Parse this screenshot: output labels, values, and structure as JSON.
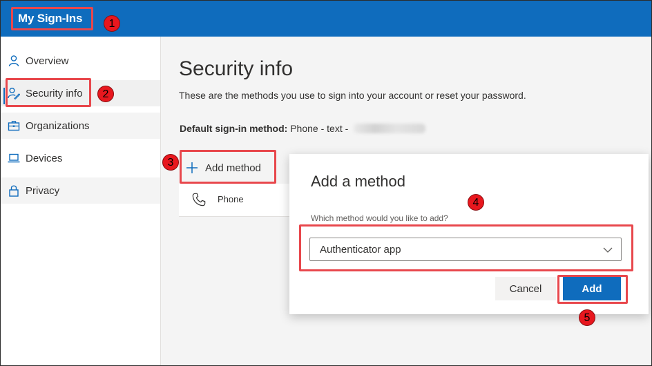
{
  "header": {
    "app_title": "My Sign-Ins"
  },
  "sidebar": {
    "items": [
      {
        "label": "Overview",
        "icon": "person-icon"
      },
      {
        "label": "Security info",
        "icon": "person-key-icon",
        "active": true
      },
      {
        "label": "Organizations",
        "icon": "briefcase-icon"
      },
      {
        "label": "Devices",
        "icon": "laptop-icon"
      },
      {
        "label": "Privacy",
        "icon": "lock-icon"
      }
    ]
  },
  "main": {
    "title": "Security info",
    "subtitle": "These are the methods you use to sign into your account or reset your password.",
    "default_method_label": "Default sign-in method:",
    "default_method_value": "Phone - text -",
    "add_method_label": "Add method",
    "methods": [
      {
        "label": "Phone",
        "icon": "phone-icon"
      }
    ]
  },
  "dialog": {
    "title": "Add a method",
    "question": "Which method would you like to add?",
    "selected_option": "Authenticator app",
    "cancel_label": "Cancel",
    "add_label": "Add"
  },
  "annotations": {
    "step_1": "1",
    "step_2": "2",
    "step_3": "3",
    "step_4": "4",
    "step_5": "5"
  },
  "colors": {
    "brand_blue": "#0f6cbd",
    "annotation_red": "#e8474c",
    "page_background": "#f4f4f4"
  }
}
